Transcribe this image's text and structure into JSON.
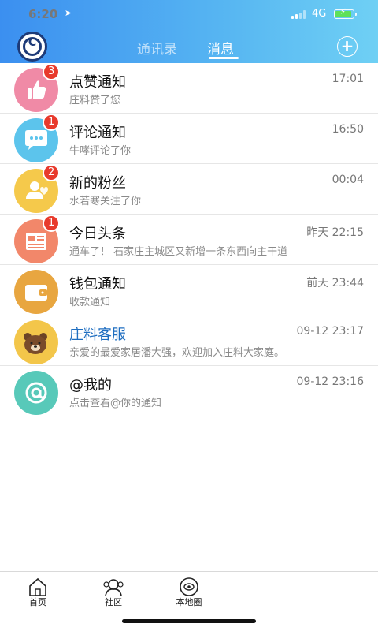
{
  "status_bar": {
    "time": "6:20",
    "network": "4G"
  },
  "header": {
    "tabs": [
      {
        "label": "通讯录",
        "active": false
      },
      {
        "label": "消息",
        "active": true
      }
    ],
    "add_label": "+"
  },
  "messages": [
    {
      "title": "点赞通知",
      "subtitle": "庄料赞了您",
      "time": "17:01",
      "badge": "3",
      "icon": "thumbs-up-icon",
      "color": "#f08aa6"
    },
    {
      "title": "评论通知",
      "subtitle": "牛哮评论了你",
      "time": "16:50",
      "badge": "1",
      "icon": "comment-icon",
      "color": "#5cc4ec"
    },
    {
      "title": "新的粉丝",
      "subtitle": "水若寒关注了你",
      "time": "00:04",
      "badge": "2",
      "icon": "new-follower-icon",
      "color": "#f5c94b"
    },
    {
      "title": "今日头条",
      "subtitle": "通车了！ 石家庄主城区又新增一条东西向主干道",
      "time": "昨天 22:15",
      "badge": "1",
      "icon": "newspaper-icon",
      "color": "#f2876a"
    },
    {
      "title": "钱包通知",
      "subtitle": "收款通知",
      "time": "前天 23:44",
      "badge": "",
      "icon": "wallet-icon",
      "color": "#e8a640"
    },
    {
      "title": "庄料客服",
      "subtitle": "亲爱的最爱家居潘大强，欢迎加入庄料大家庭。",
      "time": "09-12 23:17",
      "badge": "",
      "icon": "bear-avatar-icon",
      "color": "#f3c64a"
    },
    {
      "title": "@我的",
      "subtitle": "点击查看@你的通知",
      "time": "09-12 23:16",
      "badge": "",
      "icon": "at-sign-icon",
      "color": "#58c9b9"
    }
  ],
  "bottom_nav": [
    {
      "label": "首页",
      "icon": "home-icon"
    },
    {
      "label": "社区",
      "icon": "community-icon"
    },
    {
      "label": "本地圈",
      "icon": "local-circle-icon"
    }
  ]
}
